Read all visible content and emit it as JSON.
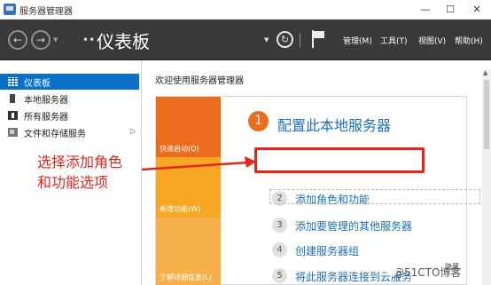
{
  "window": {
    "title": "服务器管理器",
    "min_glyph": "—",
    "max_glyph": "☐",
    "close_glyph": "✕"
  },
  "toolbar": {
    "back_glyph": "←",
    "forward_glyph": "→",
    "drop_glyph": "▼",
    "breadcrumb_arrows": "••",
    "page_title": "仪表板",
    "refresh_glyph": "↻",
    "menu": [
      {
        "label": "管理(M)"
      },
      {
        "label": "工具(T)"
      },
      {
        "label": "视图(V)"
      },
      {
        "label": "帮助(H)"
      }
    ]
  },
  "sidebar": {
    "items": [
      {
        "label": "仪表板",
        "icon": "dashboard-icon",
        "active": true
      },
      {
        "label": "本地服务器",
        "icon": "server-icon"
      },
      {
        "label": "所有服务器",
        "icon": "servers-icon"
      },
      {
        "label": "文件和存储服务",
        "icon": "storage-icon",
        "chevron": "▷"
      }
    ]
  },
  "main": {
    "welcome_title": "欢迎使用服务器管理器",
    "tiles": [
      {
        "label": "快速启动(Q)",
        "color": "#ec6c1e"
      },
      {
        "label": "新增功能(W)",
        "color": "#f5a623"
      },
      {
        "label": "了解详细信息(L)",
        "color": "#f7b14a"
      }
    ],
    "steps": [
      {
        "number": "1",
        "label": "配置此本地服务器"
      },
      {
        "number": "2",
        "label": "添加角色和功能"
      },
      {
        "number": "3",
        "label": "添加要管理的其他服务器"
      },
      {
        "number": "4",
        "label": "创建服务器组"
      },
      {
        "number": "5",
        "label": "将此服务器连接到云服务"
      }
    ],
    "hide_label": "隐藏"
  },
  "annotation": {
    "line1": "选择添加角色",
    "line2": "和功能选项",
    "color": "#e8231b"
  },
  "watermark": "@51CTO博客",
  "colors": {
    "accent": "#0a71c9",
    "header_bg": "#3a3a3a",
    "orange": "#ec6c1e",
    "link": "#1f6fb5"
  }
}
